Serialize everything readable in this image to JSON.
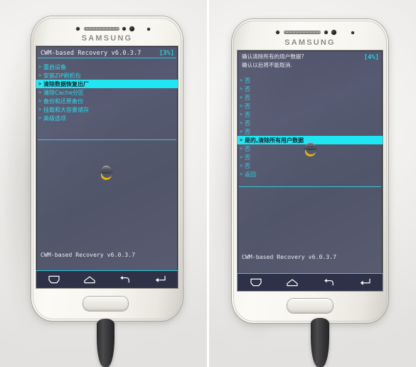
{
  "scene": {
    "description": "Two photos of a white Samsung Galaxy phone running ClockworkMod Recovery",
    "device_brand": "SAMSUNG",
    "background_color": "#eeedeb"
  },
  "panels": [
    {
      "id": "left",
      "screen": {
        "title": "CWM-based Recovery v6.0.3.7",
        "battery": "[3%]",
        "accent_color": "#1ee6f2",
        "header_lines": [],
        "menu": [
          {
            "label": "重启设备",
            "chevron": ">",
            "selected": false
          },
          {
            "label": "安装ZIP刷机包",
            "chevron": ">",
            "selected": false
          },
          {
            "label": "清除数据恢复出厂",
            "chevron": ">",
            "selected": true
          },
          {
            "label": "清除Cache分区",
            "chevron": ">",
            "selected": false
          },
          {
            "label": "备份和还原备份",
            "chevron": ">",
            "selected": false
          },
          {
            "label": "挂载和大容量储存",
            "chevron": ">",
            "selected": false
          },
          {
            "label": "高级选项",
            "chevron": ">",
            "selected": false
          }
        ],
        "footer": "CWM-based Recovery v6.0.3.7",
        "navbar": [
          "menu-icon",
          "home-icon",
          "back-icon",
          "enter-icon"
        ]
      }
    },
    {
      "id": "right",
      "screen": {
        "title": "",
        "battery": "[4%]",
        "accent_color": "#1ee6f2",
        "header_lines": [
          "确认清除所有的用户数据?",
          "  确认以后将不能取消."
        ],
        "menu": [
          {
            "label": "否",
            "chevron": ">",
            "selected": false
          },
          {
            "label": "否",
            "chevron": ">",
            "selected": false
          },
          {
            "label": "否",
            "chevron": ">",
            "selected": false
          },
          {
            "label": "否",
            "chevron": ">",
            "selected": false
          },
          {
            "label": "否",
            "chevron": ">",
            "selected": false
          },
          {
            "label": "否",
            "chevron": ">",
            "selected": false
          },
          {
            "label": "否",
            "chevron": ">",
            "selected": false
          },
          {
            "label": "是的,清除所有用户数据",
            "chevron": ">",
            "selected": true
          },
          {
            "label": "否",
            "chevron": ">",
            "selected": false
          },
          {
            "label": "否",
            "chevron": ">",
            "selected": false
          },
          {
            "label": "否",
            "chevron": ">",
            "selected": false
          },
          {
            "label": "返回",
            "chevron": "<",
            "selected": false
          }
        ],
        "footer": "CWM-based Recovery v6.0.3.7",
        "navbar": [
          "menu-icon",
          "home-icon",
          "back-icon",
          "enter-icon"
        ]
      }
    }
  ]
}
